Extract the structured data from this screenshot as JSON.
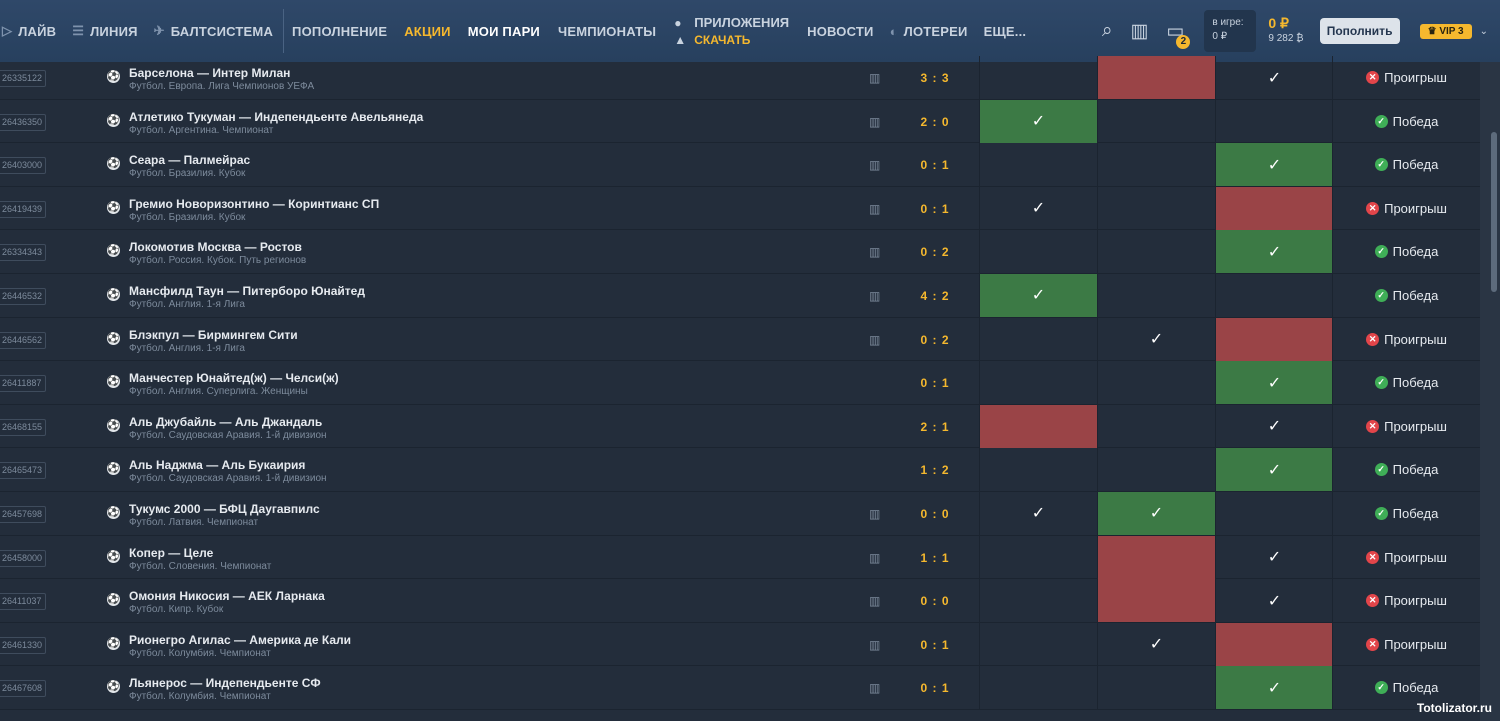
{
  "nav": {
    "live": "ЛАЙВ",
    "line": "ЛИНИЯ",
    "baltsystem": "БАЛТСИСТЕМА",
    "deposit": "ПОПОЛНЕНИЕ",
    "promo": "АКЦИИ",
    "my_bets": "МОИ ПАРИ",
    "championships": "ЧЕМПИОНАТЫ",
    "apps": "ПРИЛОЖЕНИЯ",
    "download": "СКАЧАТЬ",
    "news": "НОВОСТИ",
    "lotteries": "ЛОТЕРЕИ",
    "more": "ЕЩЕ..."
  },
  "tools": {
    "notifications_count": "2",
    "in_game_label": "в игре:",
    "in_game_value": "0 ₽",
    "balance": "0 ₽",
    "bonus": "9 282",
    "deposit_button": "Пополнить",
    "vip": "VIP 3"
  },
  "rows": [
    {
      "id": "26335122",
      "match": "Барселона — Интер Милан",
      "league": "Футбол. Европа. Лига Чемпионов УЕФА",
      "score": "3 : 3",
      "c1": "",
      "c2": "red",
      "c3": "check",
      "result": "Проигрыш",
      "win": false,
      "has_stats": true
    },
    {
      "id": "26436350",
      "match": "Атлетико Тукуман — Индепендьенте Авельянеда",
      "league": "Футбол. Аргентина. Чемпионат",
      "score": "2 : 0",
      "c1": "green",
      "c2": "",
      "c3": "",
      "result": "Победа",
      "win": true,
      "has_stats": true
    },
    {
      "id": "26403000",
      "match": "Сеара — Палмейрас",
      "league": "Футбол. Бразилия. Кубок",
      "score": "0 : 1",
      "c1": "",
      "c2": "",
      "c3": "green",
      "result": "Победа",
      "win": true,
      "has_stats": true
    },
    {
      "id": "26419439",
      "match": "Гремио Новоризонтино — Коринтианс СП",
      "league": "Футбол. Бразилия. Кубок",
      "score": "0 : 1",
      "c1": "check",
      "c2": "",
      "c3": "red",
      "result": "Проигрыш",
      "win": false,
      "has_stats": true
    },
    {
      "id": "26334343",
      "match": "Локомотив Москва — Ростов",
      "league": "Футбол. Россия. Кубок. Путь регионов",
      "score": "0 : 2",
      "c1": "",
      "c2": "",
      "c3": "green",
      "result": "Победа",
      "win": true,
      "has_stats": true
    },
    {
      "id": "26446532",
      "match": "Мансфилд Таун — Питерборо Юнайтед",
      "league": "Футбол. Англия. 1-я Лига",
      "score": "4 : 2",
      "c1": "green",
      "c2": "",
      "c3": "",
      "result": "Победа",
      "win": true,
      "has_stats": true
    },
    {
      "id": "26446562",
      "match": "Блэкпул — Бирмингем Сити",
      "league": "Футбол. Англия. 1-я Лига",
      "score": "0 : 2",
      "c1": "",
      "c2": "check",
      "c3": "red",
      "result": "Проигрыш",
      "win": false,
      "has_stats": true
    },
    {
      "id": "26411887",
      "match": "Манчестер Юнайтед(ж) — Челси(ж)",
      "league": "Футбол. Англия. Суперлига. Женщины",
      "score": "0 : 1",
      "c1": "",
      "c2": "",
      "c3": "green",
      "result": "Победа",
      "win": true,
      "has_stats": false
    },
    {
      "id": "26468155",
      "match": "Аль Джубайль — Аль Джандаль",
      "league": "Футбол. Саудовская Аравия. 1-й дивизион",
      "score": "2 : 1",
      "c1": "red",
      "c2": "",
      "c3": "check",
      "result": "Проигрыш",
      "win": false,
      "has_stats": false
    },
    {
      "id": "26465473",
      "match": "Аль Наджма — Аль Букаирия",
      "league": "Футбол. Саудовская Аравия. 1-й дивизион",
      "score": "1 : 2",
      "c1": "",
      "c2": "",
      "c3": "green",
      "result": "Победа",
      "win": true,
      "has_stats": false
    },
    {
      "id": "26457698",
      "match": "Тукумс 2000 — БФЦ Даугавпилс",
      "league": "Футбол. Латвия. Чемпионат",
      "score": "0 : 0",
      "c1": "check",
      "c2": "green",
      "c3": "",
      "result": "Победа",
      "win": true,
      "has_stats": true
    },
    {
      "id": "26458000",
      "match": "Копер — Целе",
      "league": "Футбол. Словения. Чемпионат",
      "score": "1 : 1",
      "c1": "",
      "c2": "red",
      "c3": "check",
      "result": "Проигрыш",
      "win": false,
      "has_stats": true
    },
    {
      "id": "26411037",
      "match": "Омония Никосия — АЕК Ларнака",
      "league": "Футбол. Кипр. Кубок",
      "score": "0 : 0",
      "c1": "",
      "c2": "red",
      "c3": "check",
      "result": "Проигрыш",
      "win": false,
      "has_stats": true
    },
    {
      "id": "26461330",
      "match": "Рионегро Агилас — Америка де Кали",
      "league": "Футбол. Колумбия. Чемпионат",
      "score": "0 : 1",
      "c1": "",
      "c2": "check",
      "c3": "red",
      "result": "Проигрыш",
      "win": false,
      "has_stats": true
    },
    {
      "id": "26467608",
      "match": "Льянерос — Индепендьенте СФ",
      "league": "Футбол. Колумбия. Чемпионат",
      "score": "0 : 1",
      "c1": "",
      "c2": "",
      "c3": "green",
      "result": "Победа",
      "win": true,
      "has_stats": true
    }
  ],
  "watermark": "Totolizator.ru",
  "colors": {
    "accent": "#f5b82e",
    "win_cell": "#3c7a45",
    "lose_cell": "#9a4447",
    "win_icon": "#3fae57",
    "lose_icon": "#e2454a"
  }
}
